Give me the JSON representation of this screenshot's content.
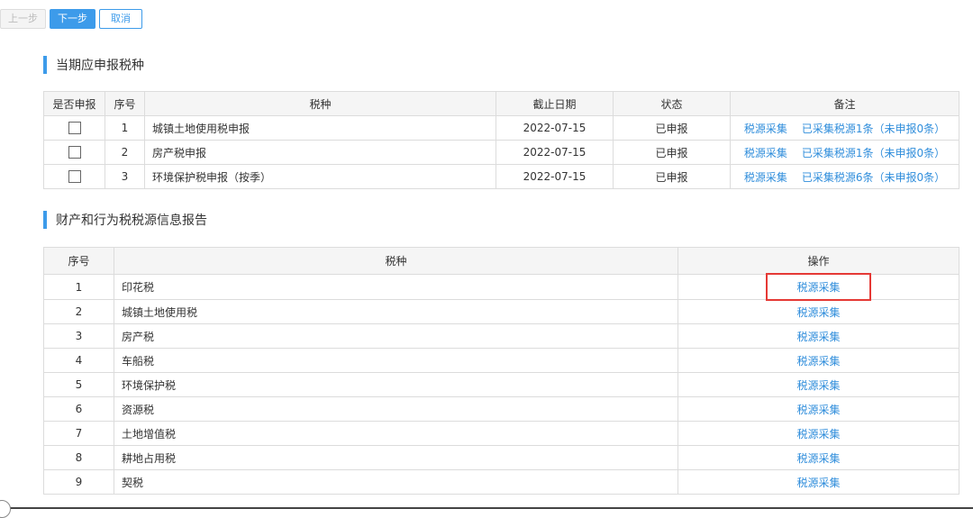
{
  "toolbar": {
    "prev": "上一步",
    "next": "下一步",
    "cancel": "取消"
  },
  "section1": {
    "title": "当期应申报税种",
    "headers": [
      "是否申报",
      "序号",
      "税种",
      "截止日期",
      "状态",
      "备注"
    ],
    "rows": [
      {
        "no": "1",
        "name": "城镇土地使用税申报",
        "deadline": "2022-07-15",
        "status": "已申报",
        "link": "税源采集",
        "note": "已采集税源1条（未申报0条）"
      },
      {
        "no": "2",
        "name": "房产税申报",
        "deadline": "2022-07-15",
        "status": "已申报",
        "link": "税源采集",
        "note": "已采集税源1条（未申报0条）"
      },
      {
        "no": "3",
        "name": "环境保护税申报（按季）",
        "deadline": "2022-07-15",
        "status": "已申报",
        "link": "税源采集",
        "note": "已采集税源6条（未申报0条）"
      }
    ]
  },
  "section2": {
    "title": "财产和行为税税源信息报告",
    "headers": [
      "序号",
      "税种",
      "操作"
    ],
    "rows": [
      {
        "no": "1",
        "name": "印花税",
        "op": "税源采集"
      },
      {
        "no": "2",
        "name": "城镇土地使用税",
        "op": "税源采集"
      },
      {
        "no": "3",
        "name": "房产税",
        "op": "税源采集"
      },
      {
        "no": "4",
        "name": "车船税",
        "op": "税源采集"
      },
      {
        "no": "5",
        "name": "环境保护税",
        "op": "税源采集"
      },
      {
        "no": "6",
        "name": "资源税",
        "op": "税源采集"
      },
      {
        "no": "7",
        "name": "土地增值税",
        "op": "税源采集"
      },
      {
        "no": "8",
        "name": "耕地占用税",
        "op": "税源采集"
      },
      {
        "no": "9",
        "name": "契税",
        "op": "税源采集"
      }
    ]
  }
}
